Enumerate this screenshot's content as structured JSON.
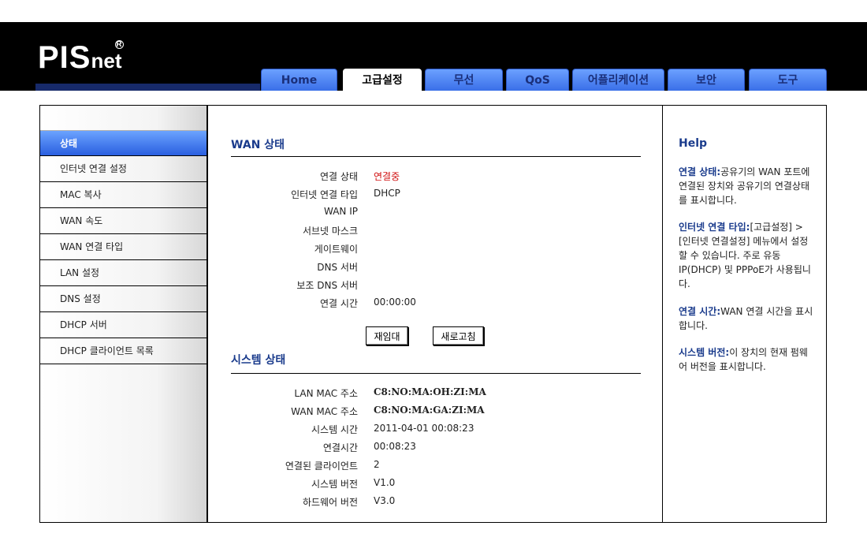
{
  "header": {
    "logo_main": "PIS",
    "logo_suffix": "net",
    "logo_reg": "R"
  },
  "tabs": [
    {
      "label": "Home"
    },
    {
      "label": "고급설정"
    },
    {
      "label": "무선"
    },
    {
      "label": "QoS"
    },
    {
      "label": "어플리케이션"
    },
    {
      "label": "보안"
    },
    {
      "label": "도구"
    }
  ],
  "sidebar": {
    "items": [
      {
        "label": "상태"
      },
      {
        "label": "인터넷 연결 설정"
      },
      {
        "label": "MAC 복사"
      },
      {
        "label": "WAN 속도"
      },
      {
        "label": "WAN 연결 타입"
      },
      {
        "label": "LAN 설정"
      },
      {
        "label": "DNS 설정"
      },
      {
        "label": "DHCP 서버"
      },
      {
        "label": "DHCP 클라이언트 목록"
      }
    ]
  },
  "wan": {
    "title": "WAN 상태",
    "rows": [
      {
        "label": "연결 상태",
        "value": "연결중"
      },
      {
        "label": "인터넷 연결 타입",
        "value": "DHCP"
      },
      {
        "label": "WAN IP",
        "value": ""
      },
      {
        "label": "서브넷 마스크",
        "value": ""
      },
      {
        "label": "게이트웨이",
        "value": ""
      },
      {
        "label": "DNS 서버",
        "value": ""
      },
      {
        "label": "보조 DNS 서버",
        "value": ""
      },
      {
        "label": "연결 시간",
        "value": "00:00:00"
      }
    ],
    "reconnect_label": "재임대",
    "refresh_label": "새로고침"
  },
  "system": {
    "title": "시스템 상태",
    "rows": [
      {
        "label": "LAN MAC 주소",
        "value": "C8:NO:MA:OH:ZI:MA"
      },
      {
        "label": "WAN MAC 주소",
        "value": "C8:NO:MA:GA:ZI:MA"
      },
      {
        "label": "시스템 시간",
        "value": "2011-04-01 00:08:23"
      },
      {
        "label": "연결시간",
        "value": "00:08:23"
      },
      {
        "label": "연결된 클라이언트",
        "value": "2"
      },
      {
        "label": "시스템 버전",
        "value": "V1.0"
      },
      {
        "label": "하드웨어 버전",
        "value": "V3.0"
      }
    ]
  },
  "help": {
    "title": "Help",
    "items": [
      {
        "key": "연결 상태:",
        "text": "공유기의 WAN 포트에 연결된 장치와 공유기의 연결상태를 표시합니다."
      },
      {
        "key": "인터넷 연결 타입:",
        "text": "[고급설정] > [인터넷 연결설정] 메뉴에서 설정할 수 있습니다. 주로 유동 IP(DHCP) 및 PPPoE가 사용됩니다."
      },
      {
        "key": "연결 시간:",
        "text": "WAN 연결 시간을 표시합니다."
      },
      {
        "key": "시스템 버전:",
        "text": "이 장치의 현재 펌웨어 버전을 표시합니다."
      }
    ]
  },
  "colors": {
    "tab_blue": "#3a6fe8",
    "title_blue": "#1a3b8c",
    "status_red": "#d01010",
    "header_black": "#000000"
  }
}
